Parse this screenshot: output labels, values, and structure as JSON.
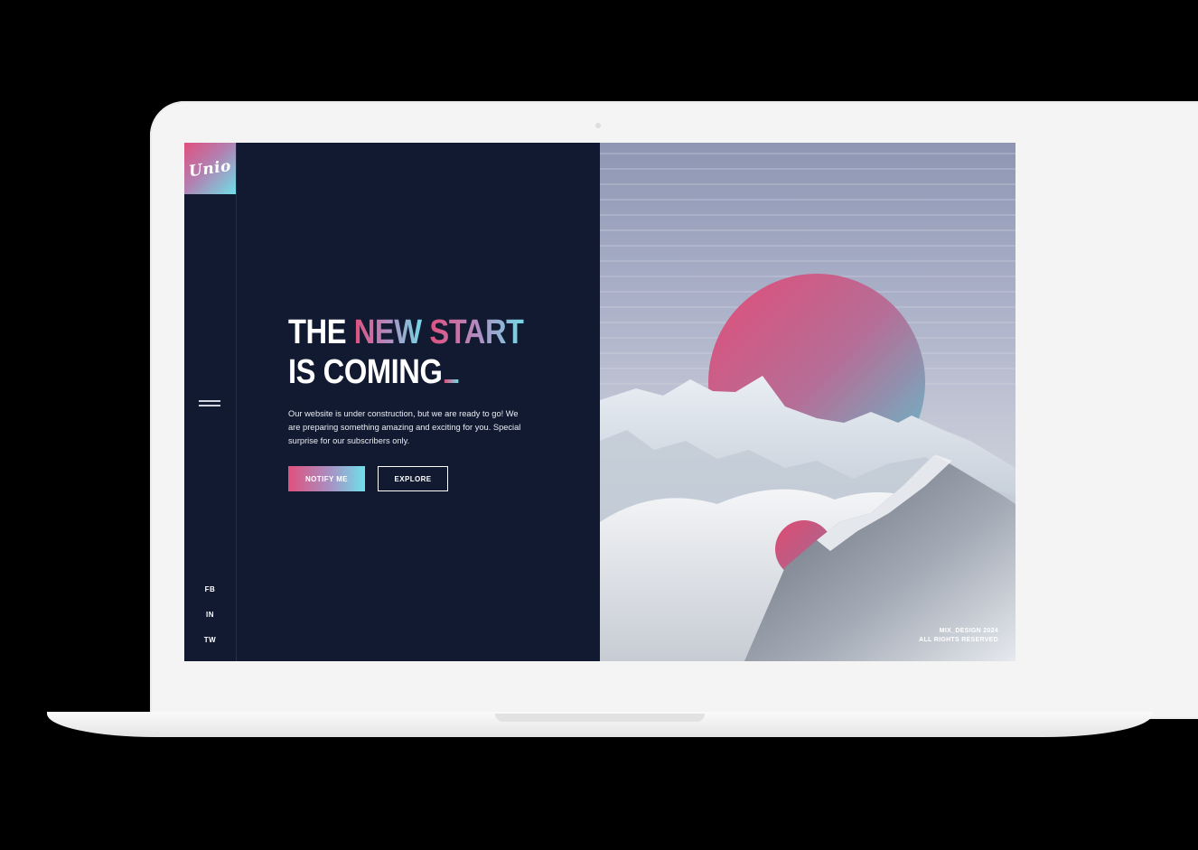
{
  "brand": {
    "logo_text": "Unio"
  },
  "hero": {
    "headline_word1": "THE",
    "headline_word2": "NEW",
    "headline_word3": "START",
    "headline_line2": "IS COMING",
    "description": "Our website is under construction, but we are ready to go! We are preparing something amazing and exciting for you. Special surprise for our subscribers only.",
    "notify_label": "NOTIFY ME",
    "explore_label": "EXPLORE"
  },
  "social": {
    "fb": "FB",
    "in": "IN",
    "tw": "TW"
  },
  "footer": {
    "copyright_line1": "MIX_DESIGN 2024",
    "copyright_line2": "ALL RIGHTS RESERVED"
  },
  "colors": {
    "background_dark": "#111a30",
    "accent_pink": "#e0507e",
    "accent_cyan": "#6fdfe8"
  },
  "icons": {
    "menu": "hamburger-menu-icon"
  }
}
